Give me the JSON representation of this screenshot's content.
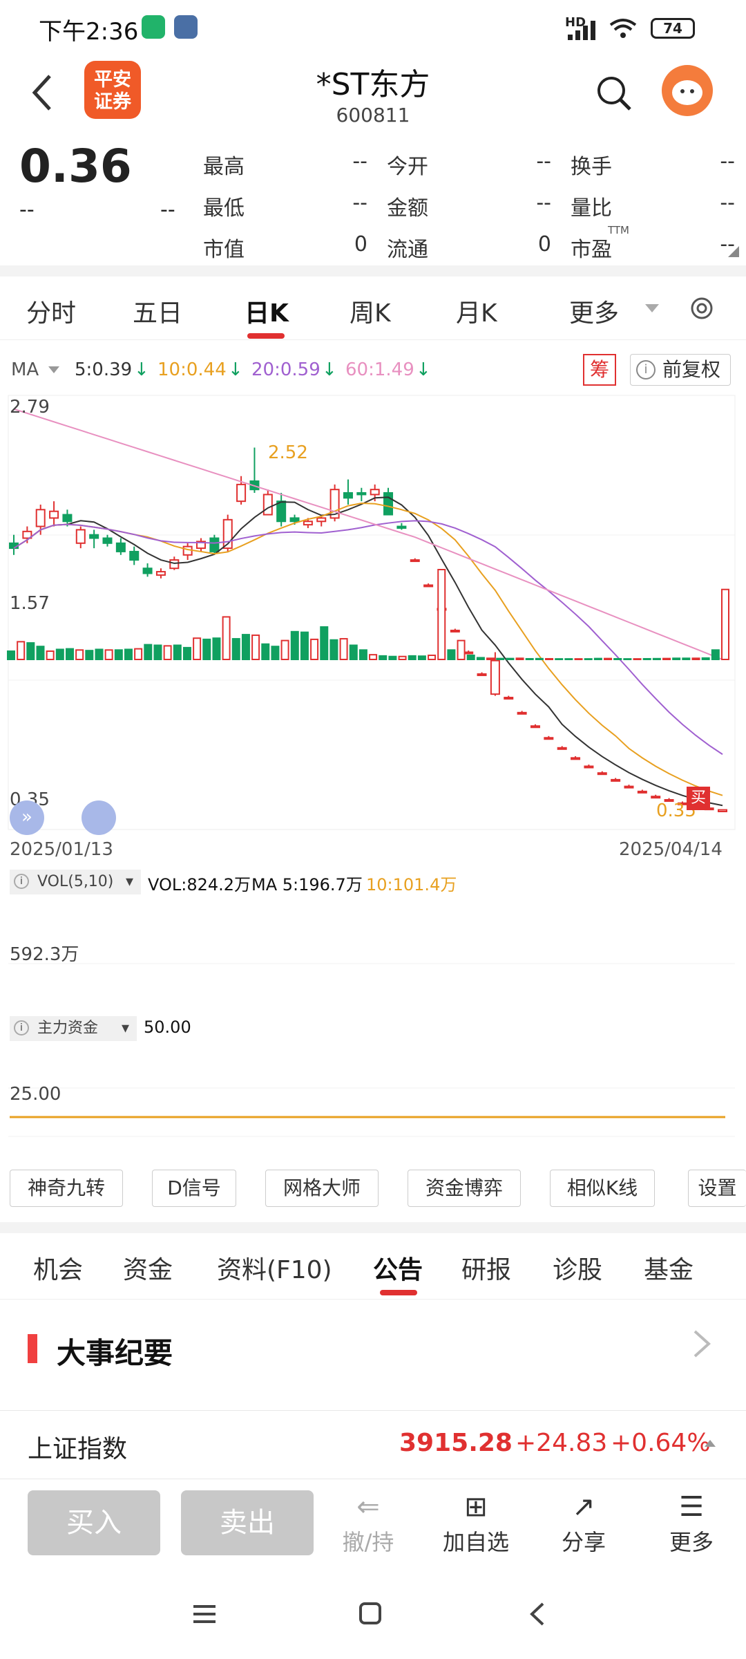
{
  "status": {
    "time": "下午2:36",
    "battery": "74",
    "network": "HD"
  },
  "header": {
    "stock_name": "*ST东方",
    "stock_code": "600811",
    "logo_line1": "平安",
    "logo_line2": "证券"
  },
  "quote": {
    "price": "0.36",
    "change": "--",
    "change_pct": "--",
    "fields": [
      {
        "label": "最高",
        "value": "--"
      },
      {
        "label": "今开",
        "value": "--"
      },
      {
        "label": "换手",
        "value": "--"
      },
      {
        "label": "最低",
        "value": "--"
      },
      {
        "label": "金额",
        "value": "--"
      },
      {
        "label": "量比",
        "value": "--"
      },
      {
        "label": "市值",
        "value": "0"
      },
      {
        "label": "流通",
        "value": "0"
      },
      {
        "label": "市盈",
        "value": "--"
      }
    ],
    "pe_superscript": "TTM"
  },
  "tabs": [
    "分时",
    "五日",
    "日K",
    "周K",
    "月K",
    "更多"
  ],
  "active_tab": "日K",
  "ma_bar": {
    "label": "MA",
    "ma5": "5:0.39",
    "ma10": "10:0.44",
    "ma20": "20:0.59",
    "ma60": "60:1.49",
    "chip_btn": "筹",
    "adjust_btn": "前复权"
  },
  "chart_labels": {
    "y_top": "2.79",
    "y_mid": "1.57",
    "y_low": "0.35",
    "high_marker": "2.52",
    "last_marker": "0.35",
    "buy_marker": "买",
    "date_start": "2025/01/13",
    "date_end": "2025/04/14"
  },
  "volume": {
    "label": "VOL(5,10)",
    "vol": "VOL:824.2万",
    "ma5": "MA 5:196.7万",
    "ma10": "10:101.4万",
    "y_label": "592.3万"
  },
  "capital": {
    "label": "主力资金",
    "value": "50.00",
    "y_label": "25.00"
  },
  "tools": [
    "神奇九转",
    "D信号",
    "网格大师",
    "资金博弈",
    "相似K线",
    "设置"
  ],
  "info_tabs": [
    "机会",
    "资金",
    "资料(F10)",
    "公告",
    "研报",
    "诊股",
    "基金"
  ],
  "active_info_tab": "公告",
  "section_title": "大事纪要",
  "index": {
    "name": "上证指数",
    "value": "3915.28",
    "change": "+24.83",
    "pct": "+0.64%"
  },
  "actions": {
    "buy": "买入",
    "sell": "卖出",
    "cancel": "撤/持",
    "add": "加自选",
    "share": "分享",
    "more": "更多"
  },
  "colors": {
    "up": "#e03030",
    "down": "#10a060",
    "ma5": "#333333",
    "ma10": "#e8a020",
    "ma20": "#a060d0",
    "ma60": "#e890c0"
  },
  "chart_data": {
    "type": "candlestick",
    "x_range": [
      "2025/01/13",
      "2025/04/14"
    ],
    "ylim": [
      0.35,
      2.79
    ],
    "ohlc": [
      [
        1.95,
        2.0,
        1.88,
        1.92
      ],
      [
        1.98,
        2.05,
        1.95,
        2.02
      ],
      [
        2.05,
        2.18,
        2.0,
        2.15
      ],
      [
        2.1,
        2.2,
        2.05,
        2.14
      ],
      [
        2.12,
        2.15,
        2.05,
        2.08
      ],
      [
        1.95,
        2.05,
        1.92,
        2.03
      ],
      [
        2.0,
        2.03,
        1.92,
        1.98
      ],
      [
        1.98,
        2.0,
        1.93,
        1.95
      ],
      [
        1.95,
        1.98,
        1.88,
        1.9
      ],
      [
        1.9,
        1.93,
        1.82,
        1.85
      ],
      [
        1.8,
        1.83,
        1.75,
        1.77
      ],
      [
        1.76,
        1.8,
        1.74,
        1.78
      ],
      [
        1.8,
        1.87,
        1.79,
        1.85
      ],
      [
        1.88,
        1.95,
        1.85,
        1.93
      ],
      [
        1.92,
        1.98,
        1.9,
        1.96
      ],
      [
        1.98,
        2.0,
        1.88,
        1.9
      ],
      [
        1.92,
        2.12,
        1.9,
        2.09
      ],
      [
        2.2,
        2.35,
        2.18,
        2.3
      ],
      [
        2.32,
        2.52,
        2.25,
        2.27
      ],
      [
        2.12,
        2.27,
        2.12,
        2.24
      ],
      [
        2.2,
        2.25,
        2.05,
        2.08
      ],
      [
        2.1,
        2.12,
        2.06,
        2.08
      ],
      [
        2.06,
        2.1,
        2.04,
        2.08
      ],
      [
        2.08,
        2.12,
        2.05,
        2.1
      ],
      [
        2.1,
        2.3,
        2.08,
        2.27
      ],
      [
        2.25,
        2.33,
        2.18,
        2.22
      ],
      [
        2.25,
        2.28,
        2.2,
        2.24
      ],
      [
        2.24,
        2.3,
        2.2,
        2.27
      ],
      [
        2.25,
        2.28,
        2.15,
        2.12
      ],
      [
        2.05,
        2.07,
        2.03,
        2.04
      ],
      [
        1.85,
        1.86,
        1.84,
        1.85
      ],
      [
        1.7,
        1.71,
        1.69,
        1.7
      ],
      [
        1.56,
        1.57,
        1.55,
        1.56
      ],
      [
        1.43,
        1.44,
        1.42,
        1.43
      ],
      [
        1.3,
        1.31,
        1.29,
        1.3
      ],
      [
        1.17,
        1.18,
        1.16,
        1.17
      ],
      [
        1.05,
        1.3,
        1.04,
        1.25
      ],
      [
        1.03,
        1.04,
        1.02,
        1.03
      ],
      [
        0.94,
        0.95,
        0.93,
        0.94
      ],
      [
        0.86,
        0.87,
        0.85,
        0.86
      ],
      [
        0.79,
        0.8,
        0.78,
        0.79
      ],
      [
        0.73,
        0.74,
        0.72,
        0.73
      ],
      [
        0.67,
        0.68,
        0.66,
        0.67
      ],
      [
        0.62,
        0.63,
        0.61,
        0.62
      ],
      [
        0.58,
        0.59,
        0.57,
        0.58
      ],
      [
        0.54,
        0.55,
        0.53,
        0.54
      ],
      [
        0.5,
        0.51,
        0.49,
        0.5
      ],
      [
        0.47,
        0.48,
        0.46,
        0.47
      ],
      [
        0.44,
        0.45,
        0.43,
        0.44
      ],
      [
        0.42,
        0.43,
        0.41,
        0.42
      ],
      [
        0.4,
        0.41,
        0.39,
        0.4
      ],
      [
        0.38,
        0.39,
        0.37,
        0.38
      ],
      [
        0.37,
        0.38,
        0.36,
        0.37
      ],
      [
        0.35,
        0.36,
        0.35,
        0.36
      ]
    ],
    "volume": [
      70,
      150,
      140,
      110,
      70,
      85,
      90,
      80,
      75,
      85,
      80,
      80,
      85,
      90,
      125,
      120,
      115,
      120,
      100,
      180,
      170,
      180,
      360,
      175,
      210,
      205,
      130,
      110,
      160,
      235,
      230,
      170,
      275,
      165,
      175,
      120,
      80,
      40,
      30,
      25,
      25,
      30,
      28,
      35,
      760,
      80,
      160,
      35,
      15,
      10,
      8,
      8,
      10,
      6,
      7,
      6,
      5,
      5,
      5,
      5,
      8,
      8,
      6,
      5,
      5,
      6,
      7,
      8,
      10,
      10,
      10,
      12,
      80,
      592
    ]
  }
}
